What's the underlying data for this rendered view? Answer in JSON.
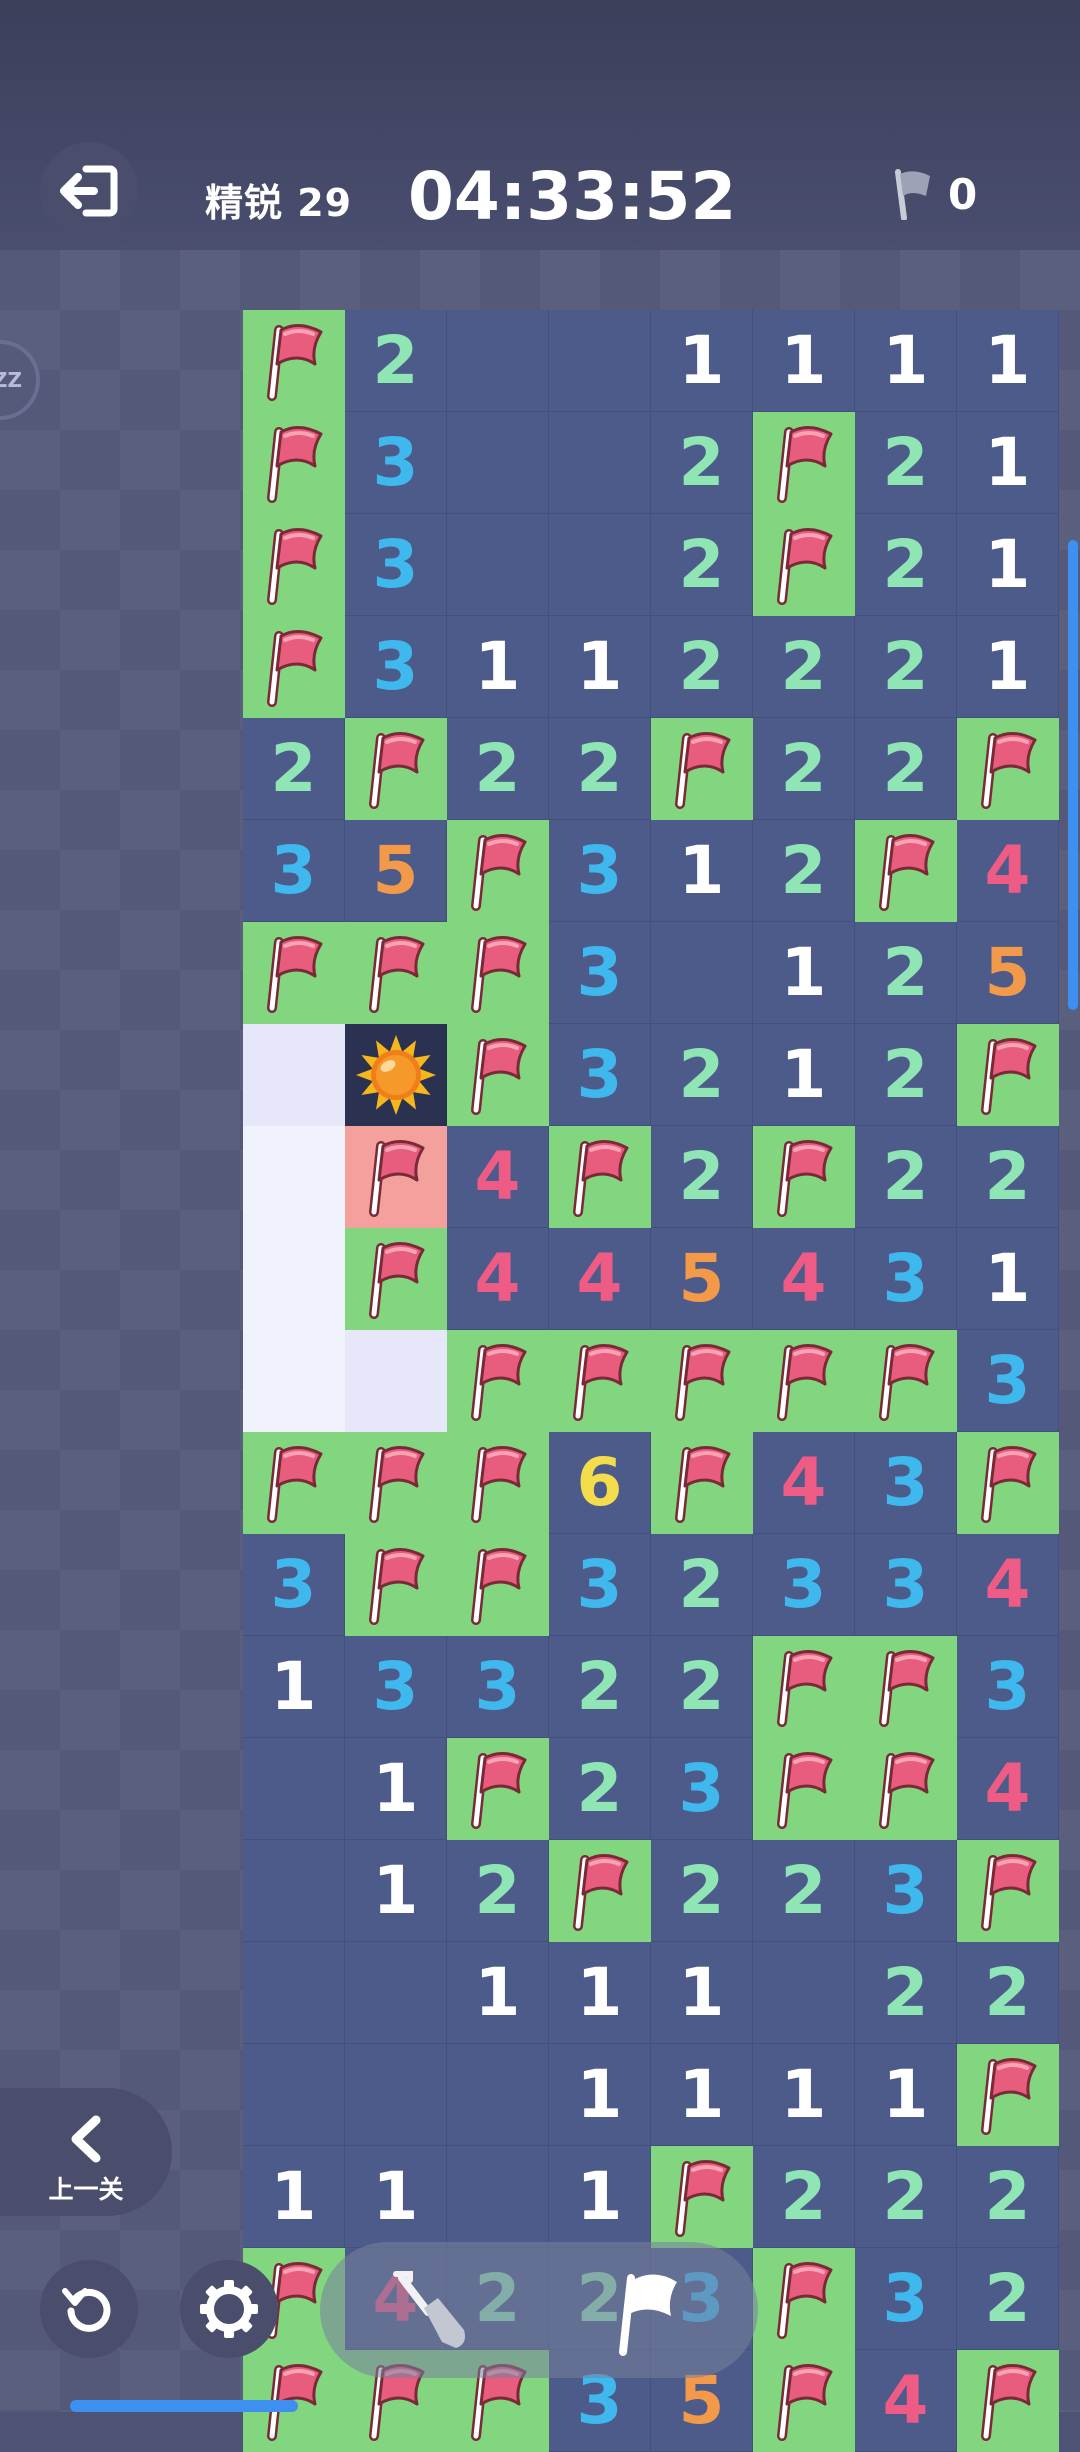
{
  "header": {
    "level_label": "精锐 29",
    "timer": "04:33:52",
    "flag_count": "0"
  },
  "board": {
    "rows_visible": 21,
    "cols_visible": 8,
    "legend": "F = flagged cell, M = revealed mine, X = wrongly flagged (red), W = unrevealed (light), '' = empty revealed, digits = adjacent mine count",
    "cells": [
      [
        "F",
        "2",
        "",
        "",
        "1",
        "1",
        "1",
        "1"
      ],
      [
        "F",
        "3",
        "",
        "",
        "2",
        "F",
        "2",
        "1"
      ],
      [
        "F",
        "3",
        "",
        "",
        "2",
        "F",
        "2",
        "1"
      ],
      [
        "F",
        "3",
        "1",
        "1",
        "2",
        "2",
        "2",
        "1"
      ],
      [
        "2",
        "F",
        "2",
        "2",
        "F",
        "2",
        "2",
        "F"
      ],
      [
        "3",
        "5",
        "F",
        "3",
        "1",
        "2",
        "F",
        "4"
      ],
      [
        "F",
        "F",
        "F",
        "3",
        "",
        "1",
        "2",
        "5"
      ],
      [
        "W",
        "M",
        "F",
        "3",
        "2",
        "1",
        "2",
        "F"
      ],
      [
        "W",
        "X",
        "4",
        "F",
        "2",
        "F",
        "2",
        "2"
      ],
      [
        "W",
        "F",
        "4",
        "4",
        "5",
        "4",
        "3",
        "1"
      ],
      [
        "W",
        "W",
        "F",
        "F",
        "F",
        "F",
        "F",
        "3"
      ],
      [
        "F",
        "F",
        "F",
        "6",
        "F",
        "4",
        "3",
        "F"
      ],
      [
        "3",
        "F",
        "F",
        "3",
        "2",
        "3",
        "3",
        "4"
      ],
      [
        "1",
        "3",
        "3",
        "2",
        "2",
        "F",
        "F",
        "3"
      ],
      [
        "",
        "1",
        "F",
        "2",
        "3",
        "F",
        "F",
        "4"
      ],
      [
        "",
        "1",
        "2",
        "F",
        "2",
        "2",
        "3",
        "F"
      ],
      [
        "",
        "",
        "1",
        "1",
        "1",
        "",
        "2",
        "2"
      ],
      [
        "",
        "",
        "",
        "1",
        "1",
        "1",
        "1",
        "F"
      ],
      [
        "1",
        "1",
        "",
        "1",
        "F",
        "2",
        "2",
        "2"
      ],
      [
        "F",
        "4",
        "2",
        "2",
        "3",
        "F",
        "3",
        "2"
      ],
      [
        "F",
        "F",
        "F",
        "3",
        "5",
        "F",
        "4",
        "F"
      ]
    ],
    "colors": {
      "1": "#ffffff",
      "2": "#8fe6b4",
      "3": "#3fb8ee",
      "4": "#ee5b84",
      "5": "#f29a4a",
      "6": "#f3dd4c"
    }
  },
  "controls": {
    "prev_level_label": "上一关",
    "restart_icon": "restart-icon",
    "settings_icon": "gear-icon",
    "shovel_icon": "shovel-icon",
    "flag_icon": "flag-icon"
  }
}
